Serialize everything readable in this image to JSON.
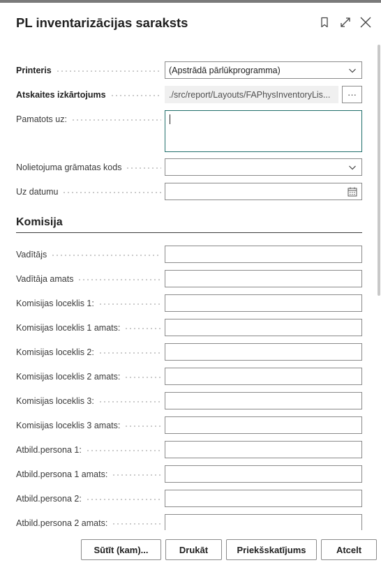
{
  "dialog": {
    "title": "PL inventarizācijas saraksts"
  },
  "header_icons": [
    "bookmark-icon",
    "expand-icon",
    "close-icon"
  ],
  "options": {
    "printer": {
      "label": "Printeris",
      "value": "(Apstrādā pārlūkprogramma)"
    },
    "report_layout": {
      "label": "Atskaites izkārtojums",
      "value": "./src/report/Layouts/FAPhysInventoryLis...",
      "button_label": "···"
    },
    "based_on": {
      "label": "Pamatots uz:",
      "value": ""
    },
    "depreciation_book": {
      "label": "Nolietojuma grāmatas kods",
      "value": ""
    },
    "as_of_date": {
      "label": "Uz datumu",
      "value": ""
    }
  },
  "commission": {
    "title": "Komisija",
    "fields": [
      {
        "label": "Vadītājs",
        "value": ""
      },
      {
        "label": "Vadītāja amats",
        "value": ""
      },
      {
        "label": "Komisijas loceklis 1:",
        "value": ""
      },
      {
        "label": "Komisijas loceklis 1 amats:",
        "value": ""
      },
      {
        "label": "Komisijas loceklis 2:",
        "value": ""
      },
      {
        "label": "Komisijas loceklis 2 amats:",
        "value": ""
      },
      {
        "label": "Komisijas loceklis 3:",
        "value": ""
      },
      {
        "label": "Komisijas loceklis 3 amats:",
        "value": ""
      },
      {
        "label": "Atbild.persona 1:",
        "value": ""
      },
      {
        "label": "Atbild.persona 1 amats:",
        "value": ""
      },
      {
        "label": "Atbild.persona 2:",
        "value": ""
      },
      {
        "label": "Atbild.persona 2 amats:",
        "value": ""
      }
    ]
  },
  "footer": {
    "send_to": "Sūtīt (kam)...",
    "print": "Drukāt",
    "preview": "Priekšskatījums",
    "cancel": "Atcelt"
  },
  "colors": {
    "accent_border": "#1f6e6a",
    "field_border": "#8a8a8a",
    "readonly_bg": "#f0f0f0"
  }
}
